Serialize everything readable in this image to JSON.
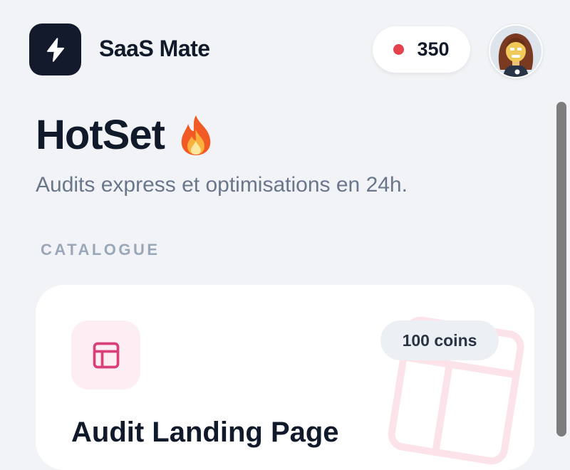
{
  "header": {
    "brand_name": "SaaS Mate",
    "logo_icon": "bolt-icon",
    "coins_balance": "350",
    "status_dot_color": "#e5424d",
    "avatar_icon": "user-avatar"
  },
  "hero": {
    "title": "HotSet",
    "title_emoji": "🔥",
    "subtitle": "Audits express et optimisations en 24h."
  },
  "catalogue": {
    "section_label": "CATALOGUE",
    "items": [
      {
        "icon": "layout-icon",
        "icon_color": "#d9407a",
        "price": "100 coins",
        "title": "Audit Landing Page"
      }
    ]
  }
}
